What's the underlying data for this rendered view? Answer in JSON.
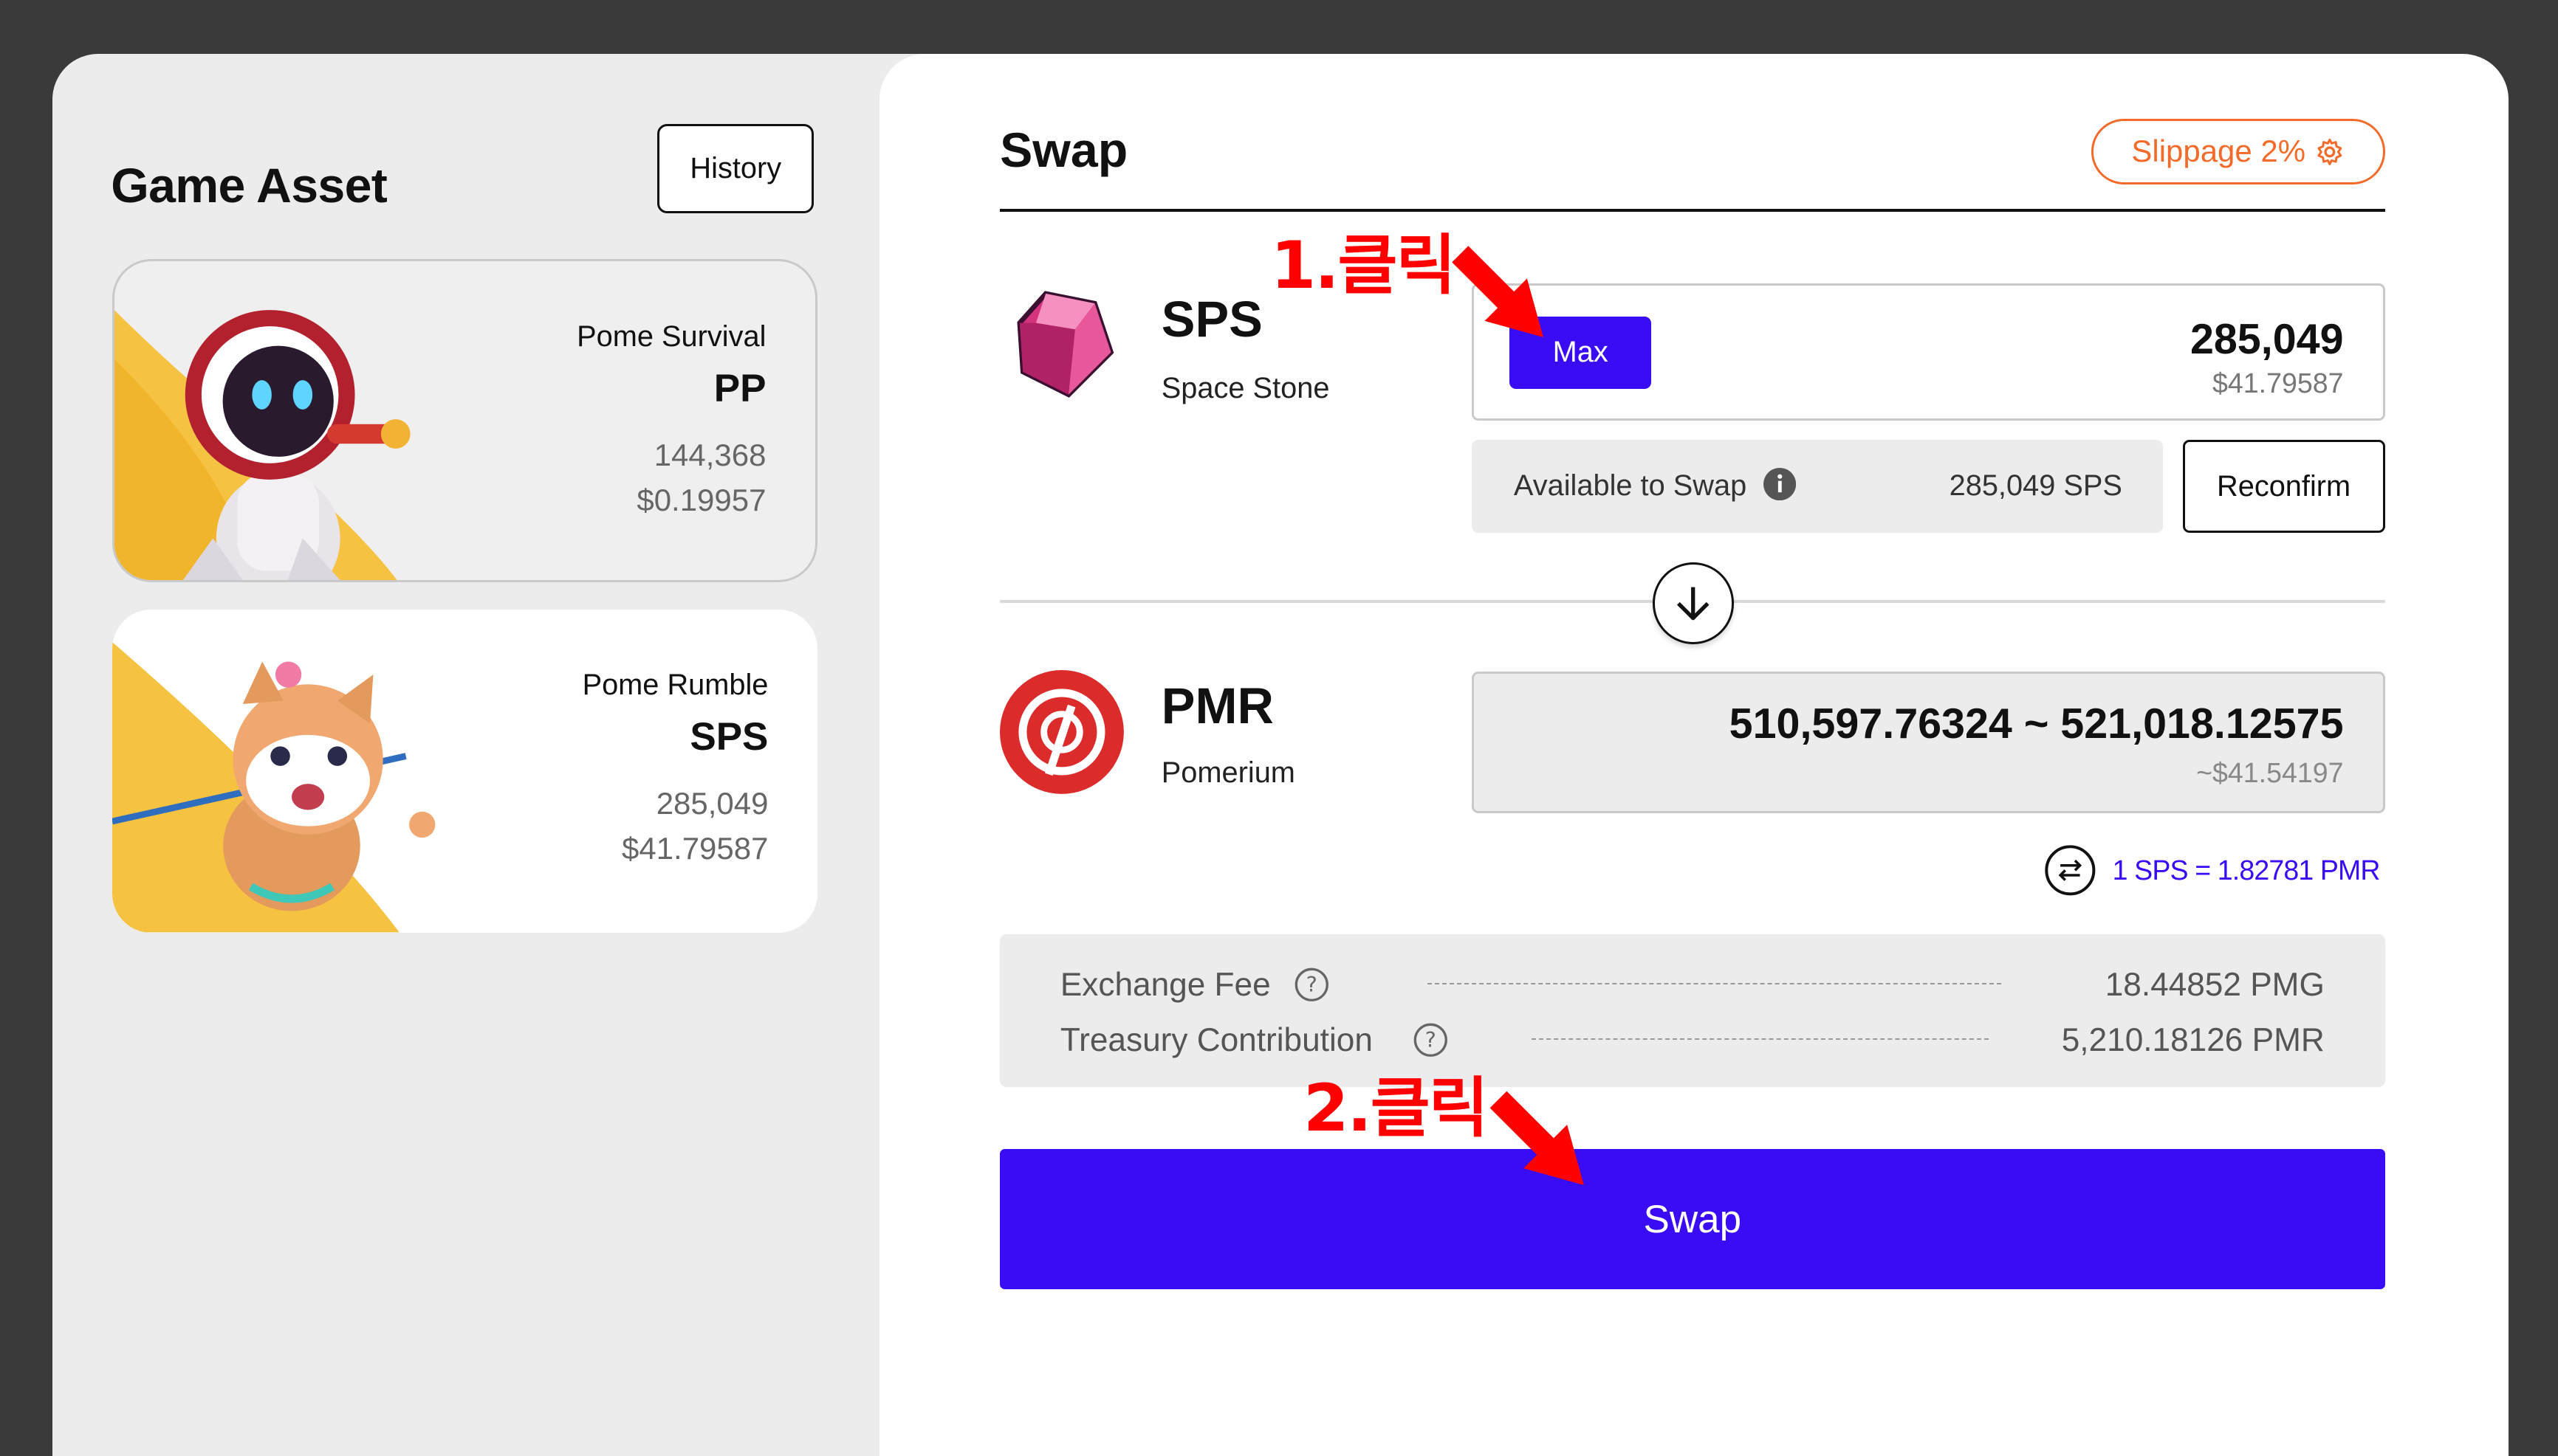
{
  "left": {
    "title": "Game Asset",
    "history_label": "History",
    "assets": [
      {
        "game": "Pome Survival",
        "symbol": "PP",
        "amount": "144,368",
        "usd": "$0.19957"
      },
      {
        "game": "Pome Rumble",
        "symbol": "SPS",
        "amount": "285,049",
        "usd": "$41.79587"
      }
    ]
  },
  "swap": {
    "title": "Swap",
    "slippage_label": "Slippage 2%",
    "from": {
      "symbol": "SPS",
      "name": "Space Stone",
      "max_label": "Max",
      "amount": "285,049",
      "usd": "$41.79587",
      "available_label": "Available to Swap",
      "available_value": "285,049 SPS",
      "reconfirm_label": "Reconfirm"
    },
    "to": {
      "symbol": "PMR",
      "name": "Pomerium",
      "amount": "510,597.76324 ~ 521,018.12575",
      "usd": "~$41.54197"
    },
    "rate": "1 SPS = 1.82781 PMR",
    "fees": [
      {
        "label": "Exchange Fee",
        "value": "18.44852 PMG"
      },
      {
        "label": "Treasury Contribution",
        "value": "5,210.18126 PMR"
      }
    ],
    "swap_label": "Swap"
  },
  "annotations": {
    "step1": "1.클릭",
    "step2": "2.클릭"
  },
  "colors": {
    "accent": "#3a0cf5",
    "slippage": "#f26b2a",
    "annotation": "#ff0000",
    "card_yellow": "#f5c242"
  },
  "icons": [
    "history",
    "gear-icon",
    "info-icon",
    "arrow-down-icon",
    "swap-direction-icon",
    "question-icon",
    "sps-gem-icon",
    "pmr-logo-icon"
  ]
}
